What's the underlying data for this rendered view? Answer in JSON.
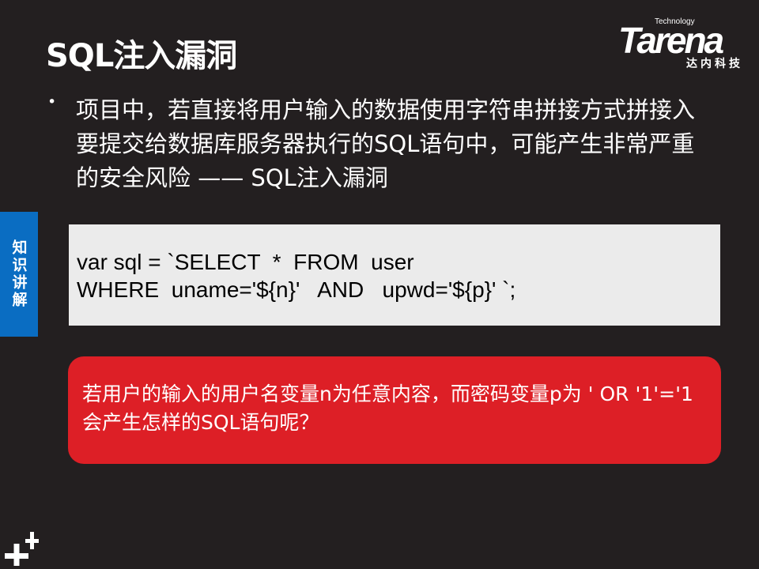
{
  "title": "SQL注入漏洞",
  "logo": {
    "tech": "Technology",
    "brand": "Tarena",
    "cn": "达内科技"
  },
  "side_tab": "知识讲解",
  "bullet": "•",
  "body_text": "项目中，若直接将用户输入的数据使用字符串拼接方式拼接入要提交给数据库服务器执行的SQL语句中，可能产生非常严重的安全风险 —— SQL注入漏洞",
  "code": {
    "line1": "var sql = `SELECT  *  FROM  user",
    "line2": "WHERE  uname='${n}'   AND   upwd='${p}' `;"
  },
  "question": "若用户的输入的用户名变量n为任意内容，而密码变量p为 ' OR '1'='1 会产生怎样的SQL语句呢？",
  "colors": {
    "background": "#231f20",
    "side_tab": "#0a6dc2",
    "callout": "#dd1f26",
    "code_bg": "#ebebeb"
  }
}
